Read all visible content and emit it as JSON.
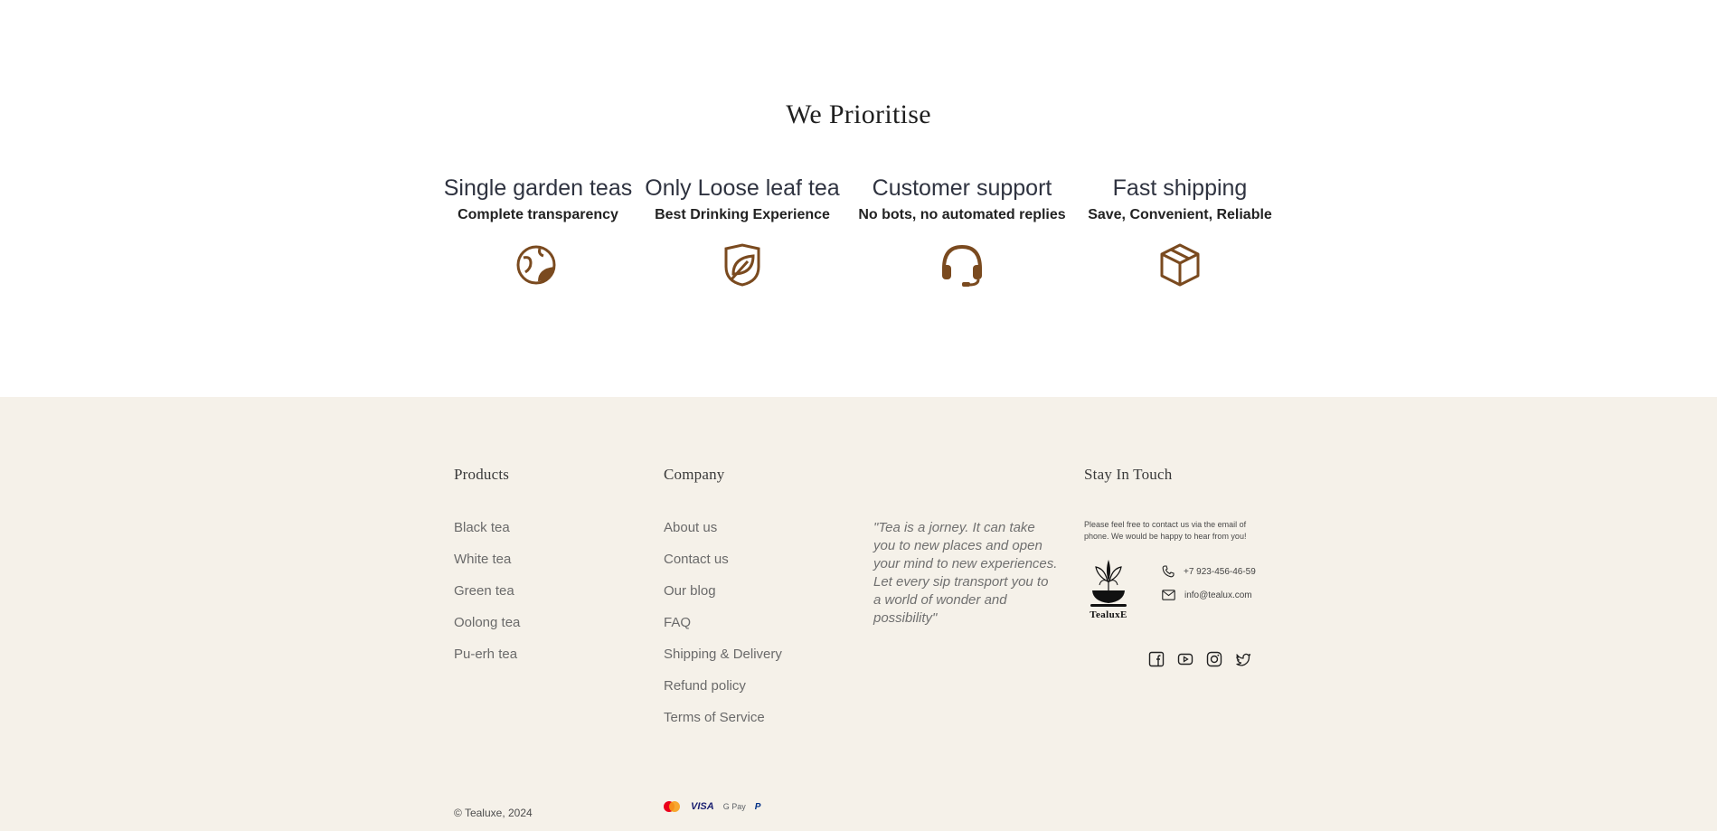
{
  "prioritise": {
    "title": "We Prioritise",
    "features": [
      {
        "title": "Single garden teas",
        "subtitle": "Complete transparency",
        "icon": "globe-leaf-icon"
      },
      {
        "title": "Only Loose leaf tea",
        "subtitle": "Best Drinking Experience",
        "icon": "leaf-shield-icon"
      },
      {
        "title": "Customer support",
        "subtitle": "No bots, no automated replies",
        "icon": "headset-icon"
      },
      {
        "title": "Fast shipping",
        "subtitle": "Save, Convenient, Reliable",
        "icon": "box-icon"
      }
    ]
  },
  "footer": {
    "products": {
      "heading": "Products",
      "links": [
        "Black tea",
        "White tea",
        "Green tea",
        "Oolong tea",
        "Pu-erh tea"
      ]
    },
    "company": {
      "heading": "Company",
      "links": [
        "About us",
        "Contact us",
        "Our blog",
        "FAQ",
        "Shipping & Delivery",
        "Refund policy",
        "Terms of Service"
      ]
    },
    "quote": "\"Tea is a jorney. It can take you to new places and open your mind to new experiences. Let every sip transport you to a world of wonder and possibility\"",
    "contact": {
      "heading": "Stay In Touch",
      "note": "Please feel free to contact us via the email of phone. We would be happy to hear from you!",
      "logo_text": "TealuxE",
      "phone": "+7 923-456-46-59",
      "email": "info@tealux.com",
      "social_icons": [
        "facebook-icon",
        "youtube-icon",
        "instagram-icon",
        "twitter-icon"
      ]
    },
    "copyright": "© Tealuxe, 2024",
    "payments": [
      "mastercard-icon",
      "visa-icon",
      "gpay-icon",
      "paypal-icon"
    ],
    "payment_labels": {
      "visa": "VISA",
      "gpay": "G Pay",
      "paypal": "P"
    }
  },
  "colors": {
    "accent": "#7a4a1f",
    "footer_bg": "#f5f1e9"
  }
}
